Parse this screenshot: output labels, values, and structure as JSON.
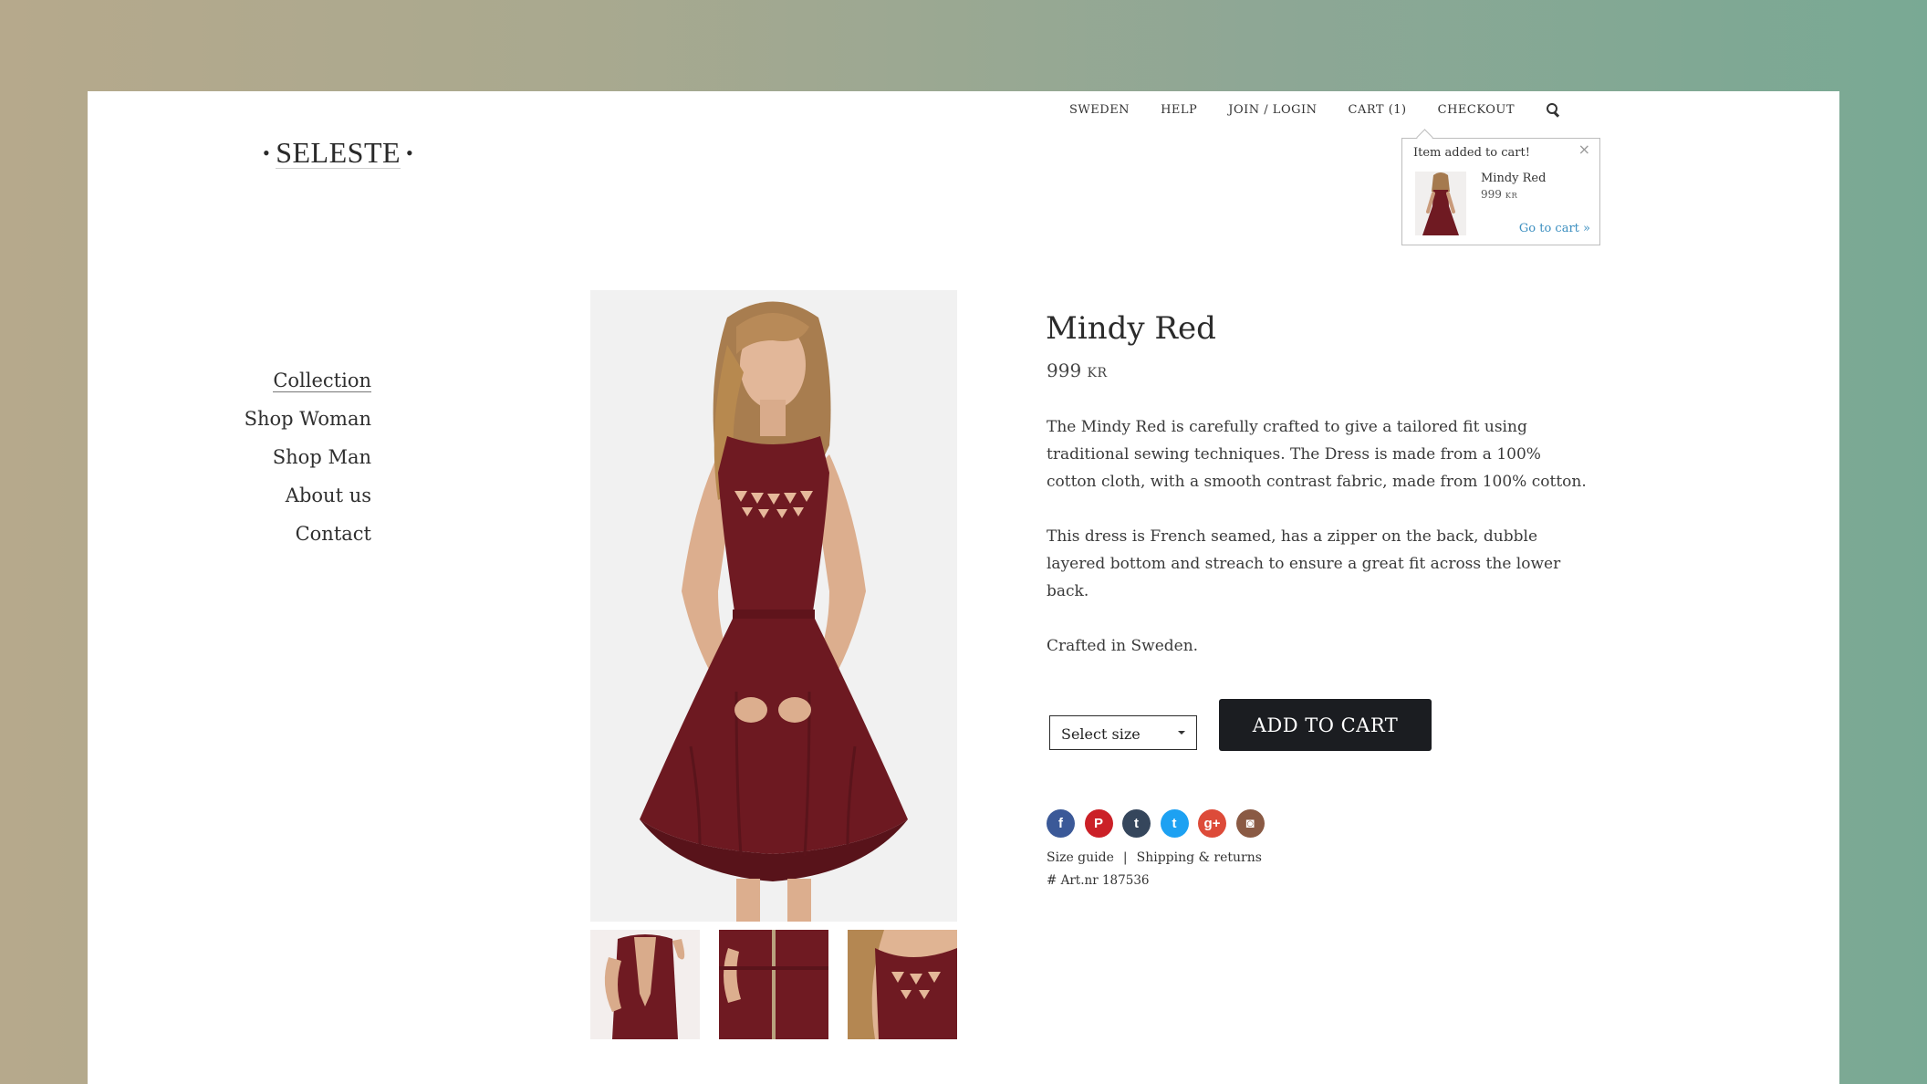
{
  "brand": {
    "logo_text": "SELESTE",
    "dot": "•"
  },
  "topnav": {
    "items": [
      "SWEDEN",
      "HELP",
      "JOIN / LOGIN",
      "CART (1)",
      "CHECKOUT"
    ],
    "search_icon": "search-icon"
  },
  "cart_popup": {
    "message": "Item added to cart!",
    "close": "×",
    "item_name": "Mindy Red",
    "item_price": "999",
    "item_currency": "KR",
    "go_to_cart": "Go to cart »"
  },
  "sidenav": {
    "items": [
      "Collection",
      "Shop Woman",
      "Shop Man",
      "About us",
      "Contact"
    ],
    "active": "Collection"
  },
  "product": {
    "title": "Mindy Red",
    "price": "999",
    "currency": "KR",
    "description": [
      "The Mindy Red is carefully crafted to give a tailored fit using traditional sewing techniques. The Dress is made from a 100% cotton  cloth, with a smooth contrast fabric, made from 100% cotton.",
      "This dress is French seamed, has a zipper on the back, dubble layered bottom and streach to ensure a great fit across the lower back.",
      "Crafted in Sweden."
    ],
    "size_select": "Select size",
    "add_to_cart": "ADD TO CART",
    "size_guide": "Size guide",
    "separator": "|",
    "shipping": "Shipping & returns",
    "art_nr": "# Art.nr 187536"
  },
  "social": {
    "icons": [
      {
        "name": "facebook-icon",
        "glyph": "f",
        "color": "#3b5998"
      },
      {
        "name": "pinterest-icon",
        "glyph": "P",
        "color": "#cb2027"
      },
      {
        "name": "tumblr-icon",
        "glyph": "t",
        "color": "#35465c"
      },
      {
        "name": "twitter-icon",
        "glyph": "t",
        "color": "#1da1f2"
      },
      {
        "name": "google-plus-icon",
        "glyph": "g+",
        "color": "#dd4b39"
      },
      {
        "name": "instagram-icon",
        "glyph": "◙",
        "color": "#8a5a44"
      }
    ]
  },
  "colors": {
    "dress": "#6f1a22",
    "button": "#1b1d21",
    "link": "#3c8fc0"
  }
}
